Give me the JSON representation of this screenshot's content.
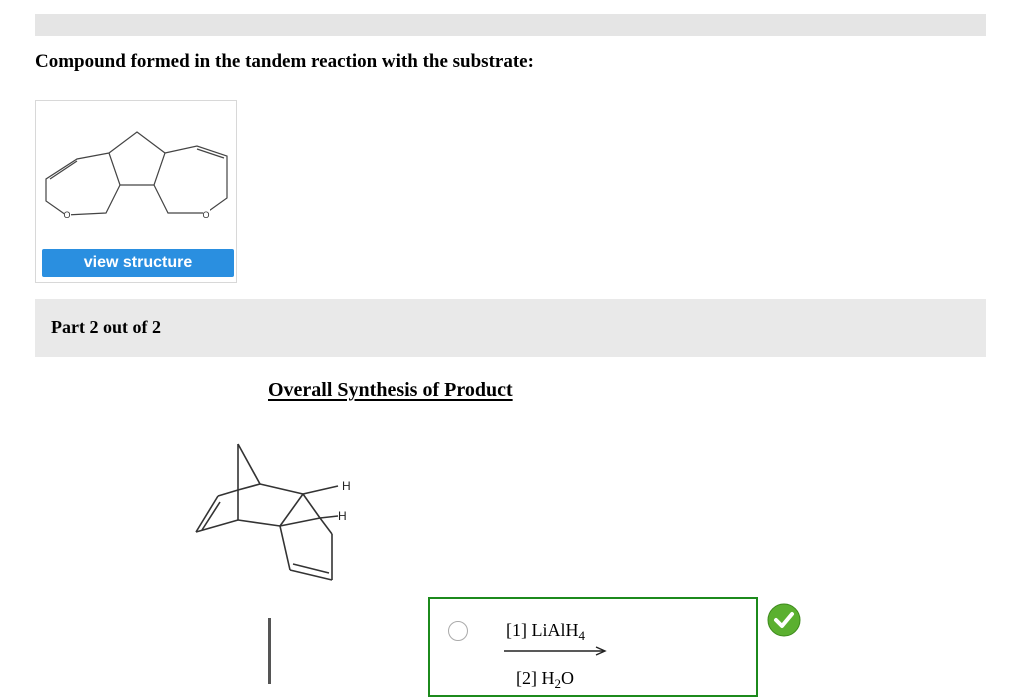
{
  "heading": "Compound formed in the tandem reaction with the substrate:",
  "card": {
    "view_button": "view structure",
    "atom_label_left": "O",
    "atom_label_right": "O"
  },
  "part": {
    "label": "Part 2 out of 2"
  },
  "synthesis": {
    "title": "Overall Synthesis of Product",
    "h_label_1": "H",
    "h_label_2": "H"
  },
  "answer": {
    "reagent_1_prefix": "[1] LiAlH",
    "reagent_1_sub": "4",
    "reagent_2_prefix": "[2] H",
    "reagent_2_sub": "2",
    "reagent_2_suffix": "O",
    "status": "correct"
  },
  "colors": {
    "accent_button": "#2a8fe0",
    "answer_border": "#1c8a1c",
    "check_green": "#5bb030"
  }
}
